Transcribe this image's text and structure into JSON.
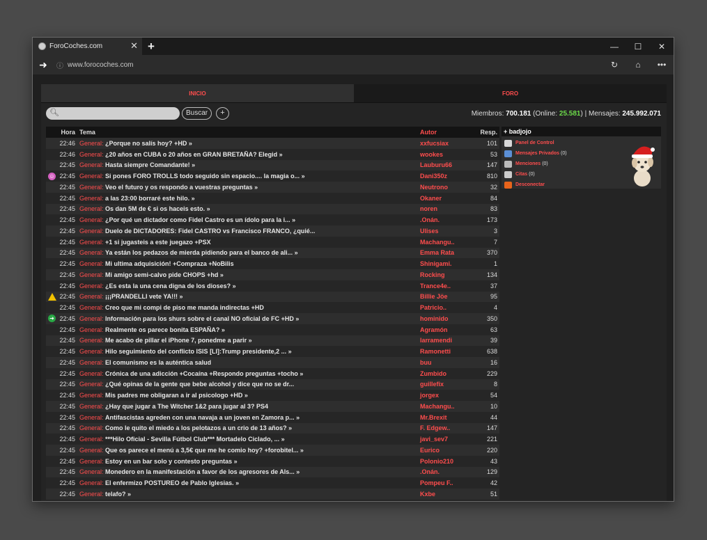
{
  "browser": {
    "tab_title": "ForoCoches.com",
    "url": "www.forocoches.com"
  },
  "nav": {
    "inicio": "INICIO",
    "foro": "FORO"
  },
  "search": {
    "placeholder": "",
    "button": "Buscar",
    "plus": "+"
  },
  "stats": {
    "members_label": "Miembros:",
    "members": "700.181",
    "online_label": "(Online:",
    "online": "25.581",
    "online_close": ")",
    "sep": "|",
    "messages_label": "Mensajes:",
    "messages": "245.992.071"
  },
  "columns": {
    "hora": "Hora",
    "tema": "Tema",
    "autor": "Autor",
    "resp": "Resp."
  },
  "threads": [
    {
      "icon": "",
      "hora": "22:46",
      "cat": "General",
      "title": "¿Porque no salís hoy? +HD »",
      "autor": "xxfucsiax",
      "resp": "101"
    },
    {
      "icon": "",
      "hora": "22:46",
      "cat": "General",
      "title": "¿20 años en CUBA o 20 años en GRAN BRETAÑA? Elegid »",
      "autor": "wookes",
      "resp": "53"
    },
    {
      "icon": "",
      "hora": "22:45",
      "cat": "General",
      "title": "Hasta siempre Comandante! »",
      "autor": "Lauburu66",
      "resp": "147"
    },
    {
      "icon": "troll",
      "hora": "22:45",
      "cat": "General",
      "title": "Si pones FORO TROLLS todo seguido sin espacio.... la magia o... »",
      "autor": "Dani350z",
      "resp": "810"
    },
    {
      "icon": "",
      "hora": "22:45",
      "cat": "General",
      "title": "Veo el futuro y os respondo a vuestras preguntas »",
      "autor": "Neutrono",
      "resp": "32"
    },
    {
      "icon": "",
      "hora": "22:45",
      "cat": "General",
      "title": "a las 23:00 borraré este hilo. »",
      "autor": "Okaner",
      "resp": "84"
    },
    {
      "icon": "",
      "hora": "22:45",
      "cat": "General",
      "title": "Os dan 5M de € si os haceis esto. »",
      "autor": "noren",
      "resp": "83"
    },
    {
      "icon": "",
      "hora": "22:45",
      "cat": "General",
      "title": "¿Por qué un dictador como Fidel Castro es un ídolo para la i... »",
      "autor": ".Onán.",
      "resp": "173"
    },
    {
      "icon": "",
      "hora": "22:45",
      "cat": "General",
      "title": "Duelo de DICTADORES: Fidel CASTRO vs Francisco FRANCO, ¿quié...",
      "autor": "Ulises",
      "resp": "3"
    },
    {
      "icon": "",
      "hora": "22:45",
      "cat": "General",
      "title": "+1 si jugasteis a este juegazo +PSX",
      "autor": "Machangu..",
      "resp": "7"
    },
    {
      "icon": "",
      "hora": "22:45",
      "cat": "General",
      "title": "Ya están los pedazos de mierda pidiendo para el banco de ali... »",
      "autor": "Emma Rata",
      "resp": "370"
    },
    {
      "icon": "",
      "hora": "22:45",
      "cat": "General",
      "title": "Mi ultima adquisición! +Compraza +NoBilis",
      "autor": "Shinigami.",
      "resp": "1"
    },
    {
      "icon": "",
      "hora": "22:45",
      "cat": "General",
      "title": "Mi amigo semi-calvo pide CHOPS +hd »",
      "autor": "Rocking",
      "resp": "134"
    },
    {
      "icon": "",
      "hora": "22:45",
      "cat": "General",
      "title": "¿Es esta la una cena digna de los dioses? »",
      "autor": "Trance4e..",
      "resp": "37"
    },
    {
      "icon": "warn",
      "hora": "22:45",
      "cat": "General",
      "title": "¡¡¡PRANDELLI vete YA!!! »",
      "autor": "Billie Jöe",
      "resp": "95"
    },
    {
      "icon": "",
      "hora": "22:45",
      "cat": "General",
      "title": "Creo que mi compi de piso me manda indirectas +HD",
      "autor": "Patricio..",
      "resp": "4"
    },
    {
      "icon": "arrow",
      "hora": "22:45",
      "cat": "General",
      "title": "Información para los shurs sobre el canal NO oficial de FC +HD »",
      "autor": "hominido",
      "resp": "350"
    },
    {
      "icon": "",
      "hora": "22:45",
      "cat": "General",
      "title": "Realmente os parece bonita ESPAÑA? »",
      "autor": "Agramón",
      "resp": "63"
    },
    {
      "icon": "",
      "hora": "22:45",
      "cat": "General",
      "title": "Me acabo de pillar el iPhone 7, ponedme a parir »",
      "autor": "larramendi",
      "resp": "39"
    },
    {
      "icon": "",
      "hora": "22:45",
      "cat": "General",
      "title": "Hilo seguimiento del conflicto ISIS [LI]:Trump presidente,2 ... »",
      "autor": "Ramonetti",
      "resp": "638"
    },
    {
      "icon": "",
      "hora": "22:45",
      "cat": "General",
      "title": "El comunismo es la auténtica salud",
      "autor": "buu",
      "resp": "16"
    },
    {
      "icon": "",
      "hora": "22:45",
      "cat": "General",
      "title": "Crónica de una adicción +Cocaína +Respondo preguntas +tocho »",
      "autor": "Zumbido",
      "resp": "229"
    },
    {
      "icon": "",
      "hora": "22:45",
      "cat": "General",
      "title": "¿Qué opinas de la gente que bebe alcohol y dice que no se dr...",
      "autor": "guillefix",
      "resp": "8"
    },
    {
      "icon": "",
      "hora": "22:45",
      "cat": "General",
      "title": "Mis padres me obligaran a ir al psicologo +HD »",
      "autor": "jorgex",
      "resp": "54"
    },
    {
      "icon": "",
      "hora": "22:45",
      "cat": "General",
      "title": "¿Hay que jugar a The Witcher 1&2 para jugar al 3? PS4",
      "autor": "Machangu..",
      "resp": "10"
    },
    {
      "icon": "",
      "hora": "22:45",
      "cat": "General",
      "title": "Antifascistas agreden con una navaja a un joven en Zamora p... »",
      "autor": "Mr.Brexit",
      "resp": "44"
    },
    {
      "icon": "",
      "hora": "22:45",
      "cat": "General",
      "title": "Como le quito el miedo a los pelotazos a un crio de 13 años? »",
      "autor": "F. Edgew..",
      "resp": "147"
    },
    {
      "icon": "",
      "hora": "22:45",
      "cat": "General",
      "title": "***Hilo Oficial - Sevilla Fútbol Club*** Mortadelo Ciclado, ... »",
      "autor": "javi_sev7",
      "resp": "221"
    },
    {
      "icon": "",
      "hora": "22:45",
      "cat": "General",
      "title": "Que os parece el menú a 3,5€ que me he comio hoy? +forobitel... »",
      "autor": "Eurico",
      "resp": "220"
    },
    {
      "icon": "",
      "hora": "22:45",
      "cat": "General",
      "title": "Estoy en un bar solo y contesto preguntas »",
      "autor": "Polonio210",
      "resp": "43"
    },
    {
      "icon": "",
      "hora": "22:45",
      "cat": "General",
      "title": "Monedero en la manifestación a favor de los agresores de Als... »",
      "autor": ".Onán.",
      "resp": "129"
    },
    {
      "icon": "",
      "hora": "22:45",
      "cat": "General",
      "title": "El enfermizo POSTUREO de Pablo Iglesias. »",
      "autor": "Pompeu F..",
      "resp": "42"
    },
    {
      "icon": "",
      "hora": "22:45",
      "cat": "General",
      "title": "telafo? »",
      "autor": "Kxbe",
      "resp": "51"
    }
  ],
  "userpanel": {
    "username": "+ badjojo",
    "links": [
      {
        "label": "Panel de Control",
        "count": "",
        "icon": "control-panel-icon",
        "color": "#d8d8d8"
      },
      {
        "label": "Mensajes Privados",
        "count": "(0)",
        "icon": "envelope-icon",
        "color": "#5b8fd6"
      },
      {
        "label": "Menciones",
        "count": "(0)",
        "icon": "at-icon",
        "color": "#bbbbbb"
      },
      {
        "label": "Citas",
        "count": "(0)",
        "icon": "quote-bubble-icon",
        "color": "#cccccc"
      },
      {
        "label": "Desconectar",
        "count": "",
        "icon": "power-icon",
        "color": "#e8641b"
      }
    ]
  },
  "colors": {
    "accent": "#ff4d4d",
    "online": "#6ddc4a",
    "bg": "#242424"
  }
}
